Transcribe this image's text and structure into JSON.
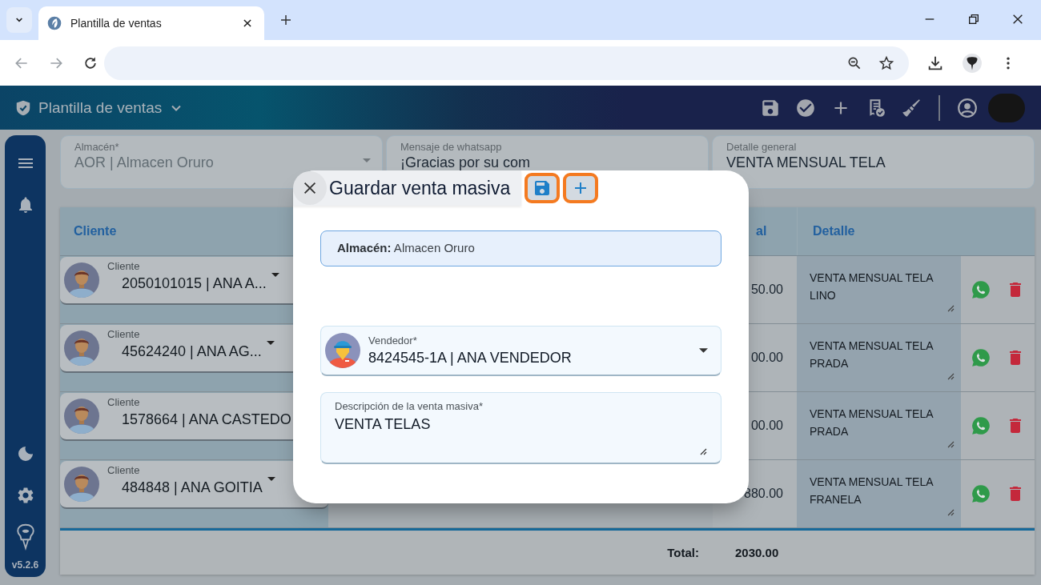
{
  "browser": {
    "tab_title": "Plantilla de ventas"
  },
  "app_bar": {
    "title": "Plantilla de ventas"
  },
  "sidebar": {
    "version": "v5.2.6"
  },
  "filters": [
    {
      "kind": "select",
      "label": "Almacén*",
      "value": "AOR | Almacen Oruro"
    },
    {
      "kind": "text",
      "label": "Mensaje de whatsapp",
      "value": "¡Gracias por su com"
    },
    {
      "kind": "text",
      "label": "Detalle general",
      "value": "VENTA MENSUAL TELA"
    }
  ],
  "table": {
    "columns": [
      "Cliente",
      "al",
      "Detalle"
    ],
    "rows": [
      {
        "client_label": "Cliente",
        "client": "2050101015 | ANA A...",
        "amount": "50.00",
        "detail": "VENTA MENSUAL TELA LINO"
      },
      {
        "client_label": "Cliente",
        "client": "45624240 | ANA AG...",
        "amount": "00.00",
        "detail": "VENTA MENSUAL TELA PRADA"
      },
      {
        "client_label": "Cliente",
        "client": "1578664 | ANA CASTEDO",
        "amount": "00.00",
        "detail": "VENTA MENSUAL TELA PRADA"
      },
      {
        "client_label": "Cliente",
        "client": "484848 | ANA GOITIA",
        "amount": "880.00",
        "detail": "VENTA MENSUAL TELA FRANELA"
      }
    ],
    "total_label": "Total:",
    "total": "2030.00"
  },
  "dialog": {
    "title": "Guardar venta masiva",
    "actions": [
      {
        "kind": "save",
        "highlighted": true
      },
      {
        "kind": "add",
        "highlighted": true
      }
    ],
    "warehouse": "**Almacén:** Almacen Oruro",
    "seller_label": "Vendedor*",
    "seller": "8424545-1A | ANA VENDEDOR",
    "description_label": "Descripción de la venta masiva*",
    "description": "VENTA TELAS"
  }
}
